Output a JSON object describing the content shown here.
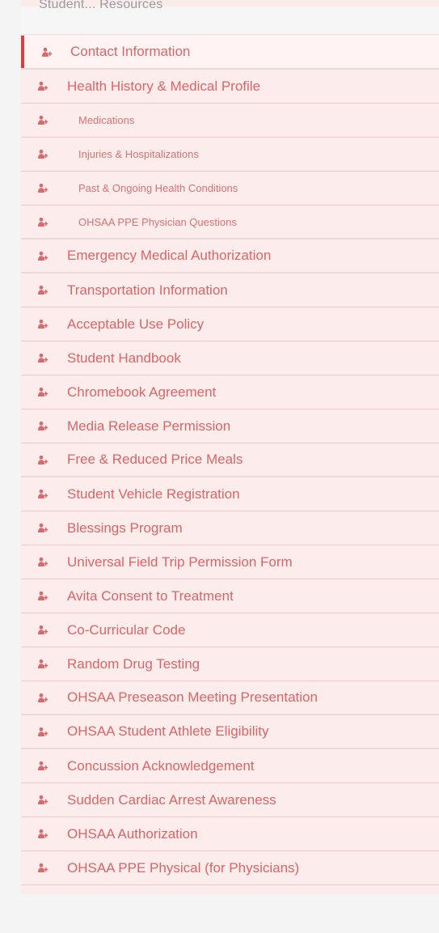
{
  "header": {
    "title": "Student... Resources"
  },
  "nav_items": [
    {
      "label": "Contact Information",
      "type": "active"
    },
    {
      "label": "Health History & Medical Profile",
      "type": "main"
    },
    {
      "label": "Medications",
      "type": "sub"
    },
    {
      "label": "Injuries & Hospitalizations",
      "type": "sub"
    },
    {
      "label": "Past & Ongoing Health Conditions",
      "type": "sub"
    },
    {
      "label": "OHSAA PPE Physician Questions",
      "type": "sub"
    },
    {
      "label": "Emergency Medical Authorization",
      "type": "main"
    },
    {
      "label": "Transportation Information",
      "type": "main"
    },
    {
      "label": "Acceptable Use Policy",
      "type": "main"
    },
    {
      "label": "Student Handbook",
      "type": "main"
    },
    {
      "label": "Chromebook Agreement",
      "type": "main"
    },
    {
      "label": "Media Release Permission",
      "type": "main"
    },
    {
      "label": "Free & Reduced Price Meals",
      "type": "main"
    },
    {
      "label": "Student Vehicle Registration",
      "type": "main"
    },
    {
      "label": "Blessings Program",
      "type": "main"
    },
    {
      "label": "Universal Field Trip Permission Form",
      "type": "main"
    },
    {
      "label": "Avita Consent to Treatment",
      "type": "main"
    },
    {
      "label": "Co-Curricular Code",
      "type": "main"
    },
    {
      "label": "Random Drug Testing",
      "type": "main"
    },
    {
      "label": "OHSAA Preseason Meeting Presentation",
      "type": "main"
    },
    {
      "label": "OHSAA Student Athlete Eligibility",
      "type": "main"
    },
    {
      "label": "Concussion Acknowledgement",
      "type": "main"
    },
    {
      "label": "Sudden Cardiac Arrest Awareness",
      "type": "main"
    },
    {
      "label": "OHSAA Authorization",
      "type": "main"
    },
    {
      "label": "OHSAA PPE Physical (for Physicians)",
      "type": "main"
    }
  ],
  "colors": {
    "accent": "#d93f3f",
    "text": "#d86666",
    "row_bg": "#fcecec",
    "divider": "#f1c8c8"
  },
  "icon": "user-plus-icon"
}
